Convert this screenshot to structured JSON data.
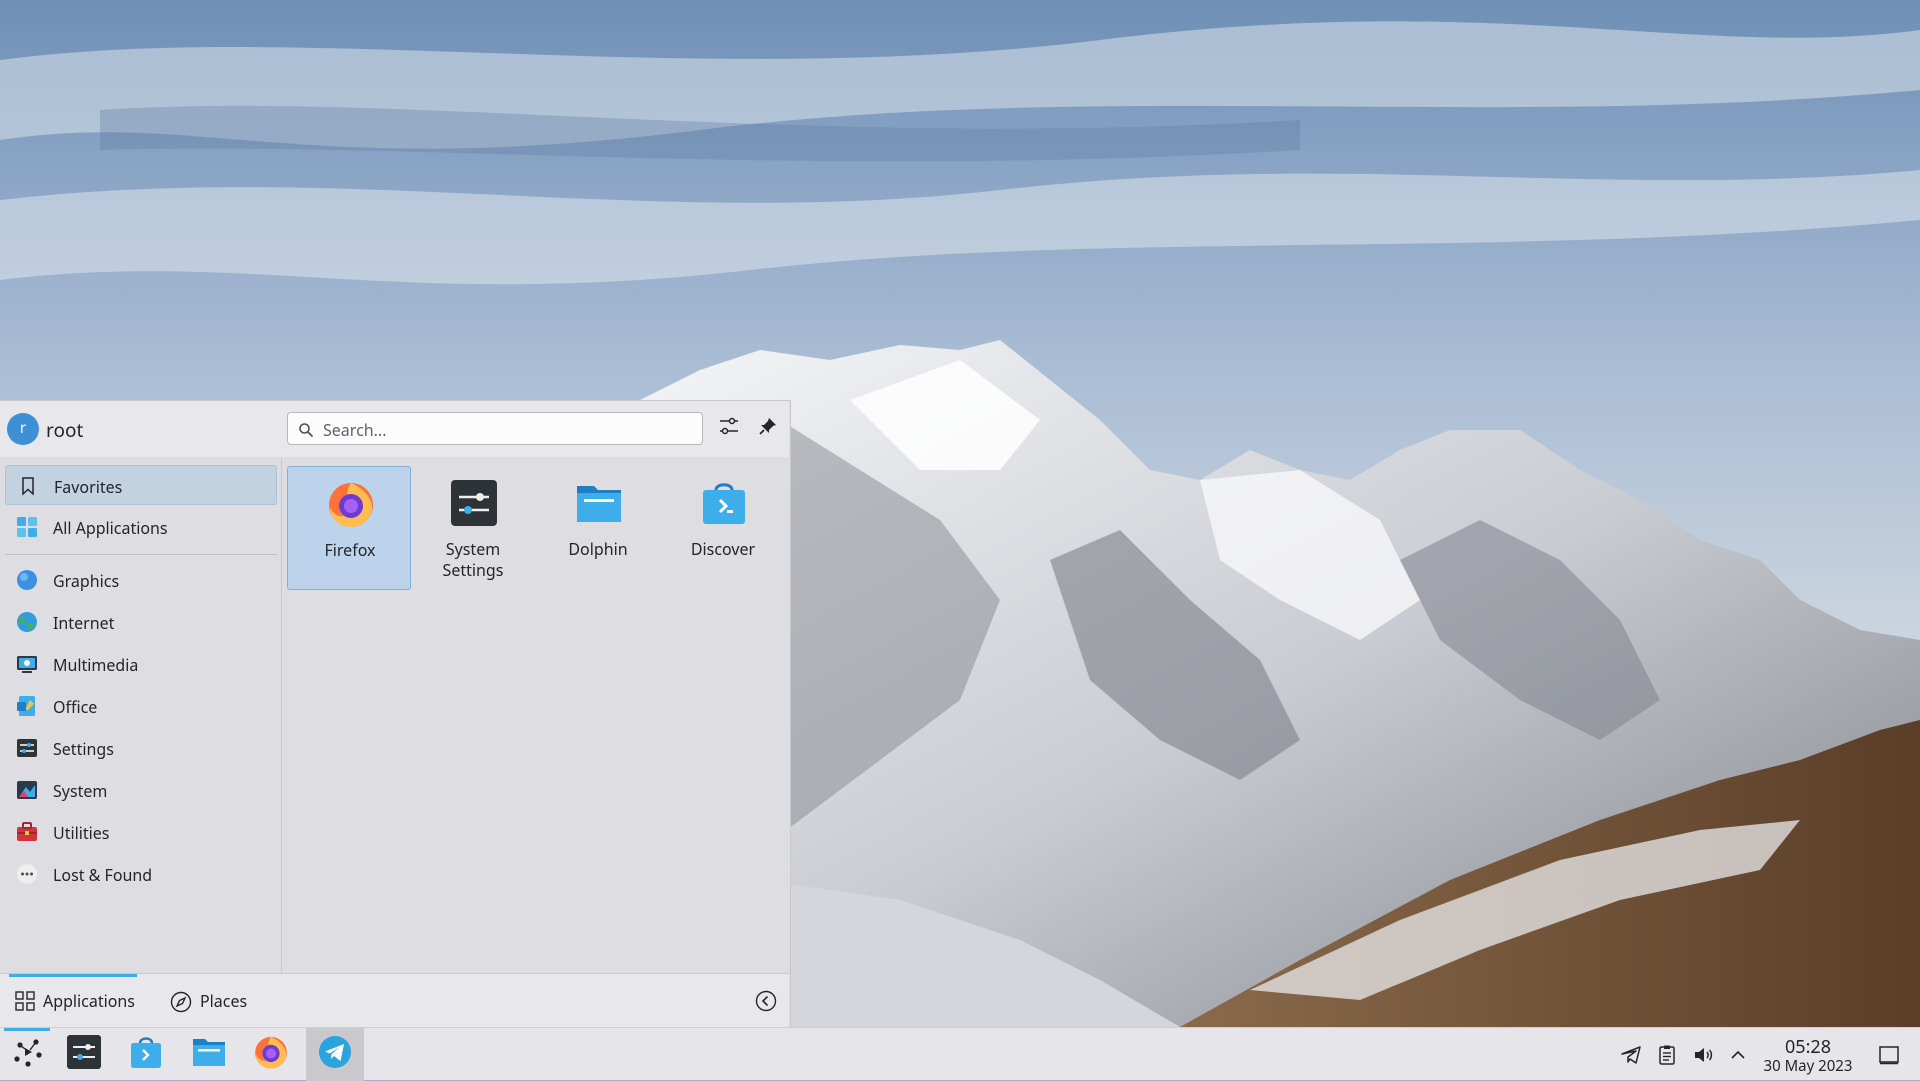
{
  "launcher": {
    "user": {
      "avatar_letter": "r",
      "name": "root"
    },
    "search": {
      "placeholder": "Search..."
    },
    "header_buttons": {
      "configure_icon": "configure-icon",
      "pin_icon": "pin-icon"
    },
    "categories": [
      {
        "label": "Favorites",
        "icon": "bookmark-icon",
        "active": true
      },
      {
        "label": "All Applications",
        "icon": "app-grid-icon"
      },
      {
        "label": "Graphics",
        "icon": "graphics-icon"
      },
      {
        "label": "Internet",
        "icon": "internet-globe-icon"
      },
      {
        "label": "Multimedia",
        "icon": "multimedia-icon"
      },
      {
        "label": "Office",
        "icon": "office-icon"
      },
      {
        "label": "Settings",
        "icon": "settings-icon"
      },
      {
        "label": "System",
        "icon": "system-icon"
      },
      {
        "label": "Utilities",
        "icon": "utilities-icon"
      },
      {
        "label": "Lost & Found",
        "icon": "lost-found-icon"
      }
    ],
    "favorites": [
      {
        "label": "Firefox",
        "icon": "firefox-icon",
        "selected": true
      },
      {
        "label": "System\nSettings",
        "icon": "system-settings-icon"
      },
      {
        "label": "Dolphin",
        "icon": "dolphin-folder-icon"
      },
      {
        "label": "Discover",
        "icon": "discover-icon"
      }
    ],
    "footer": {
      "tabs": [
        {
          "label": "Applications",
          "icon": "applications-grid-icon",
          "active": true
        },
        {
          "label": "Places",
          "icon": "compass-icon"
        }
      ],
      "power_toggle_icon": "chevron-circle-left-icon"
    }
  },
  "taskbar": {
    "pinned": [
      "application-launcher-icon",
      "system-settings-icon",
      "discover-icon",
      "dolphin-folder-icon",
      "firefox-icon",
      "telegram-icon"
    ],
    "active_task": "telegram",
    "tray": [
      "telegram-tray-icon",
      "clipboard-icon",
      "volume-icon",
      "tray-expand-arrow-icon"
    ],
    "clock": {
      "time": "05:28",
      "date": "30 May 2023"
    },
    "show_desktop_icon": "show-desktop-icon"
  },
  "colors": {
    "accent": "#3daee9",
    "panel": "#dedde2",
    "selection": "#bcd3eb"
  }
}
